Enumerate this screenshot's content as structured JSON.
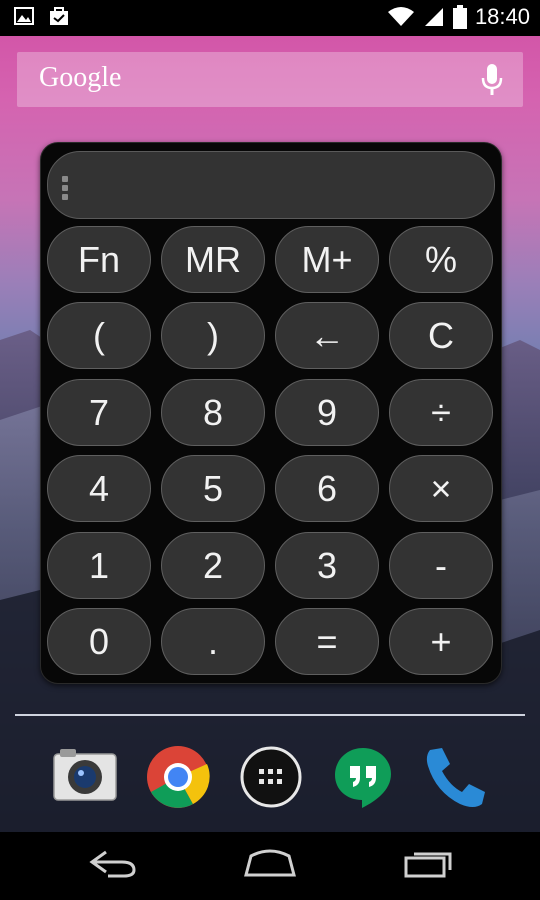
{
  "status_bar": {
    "time": "18:40",
    "left_icons": [
      "gallery-notification-icon",
      "briefcase-notification-icon"
    ],
    "right_icons": [
      "wifi-icon",
      "signal-icon",
      "battery-icon"
    ]
  },
  "search": {
    "label": "Google",
    "mic_icon": "microphone-icon"
  },
  "calculator": {
    "display_value": "",
    "keys": [
      [
        "Fn",
        "MR",
        "M+",
        "%"
      ],
      [
        "(",
        ")",
        "←",
        "C"
      ],
      [
        "7",
        "8",
        "9",
        "÷"
      ],
      [
        "4",
        "5",
        "6",
        "×"
      ],
      [
        "1",
        "2",
        "3",
        "-"
      ],
      [
        "0",
        ".",
        "=",
        "+"
      ]
    ]
  },
  "dock": {
    "apps": [
      "camera-app-icon",
      "chrome-app-icon",
      "app-drawer-icon",
      "hangouts-app-icon",
      "phone-app-icon"
    ]
  },
  "nav": {
    "buttons": [
      "back-button",
      "home-button",
      "recents-button"
    ]
  },
  "colors": {
    "key_bg": "#333333",
    "key_border": "#5f5f5f",
    "widget_bg": "#070707",
    "wallpaper_top": "#d14fa4"
  }
}
